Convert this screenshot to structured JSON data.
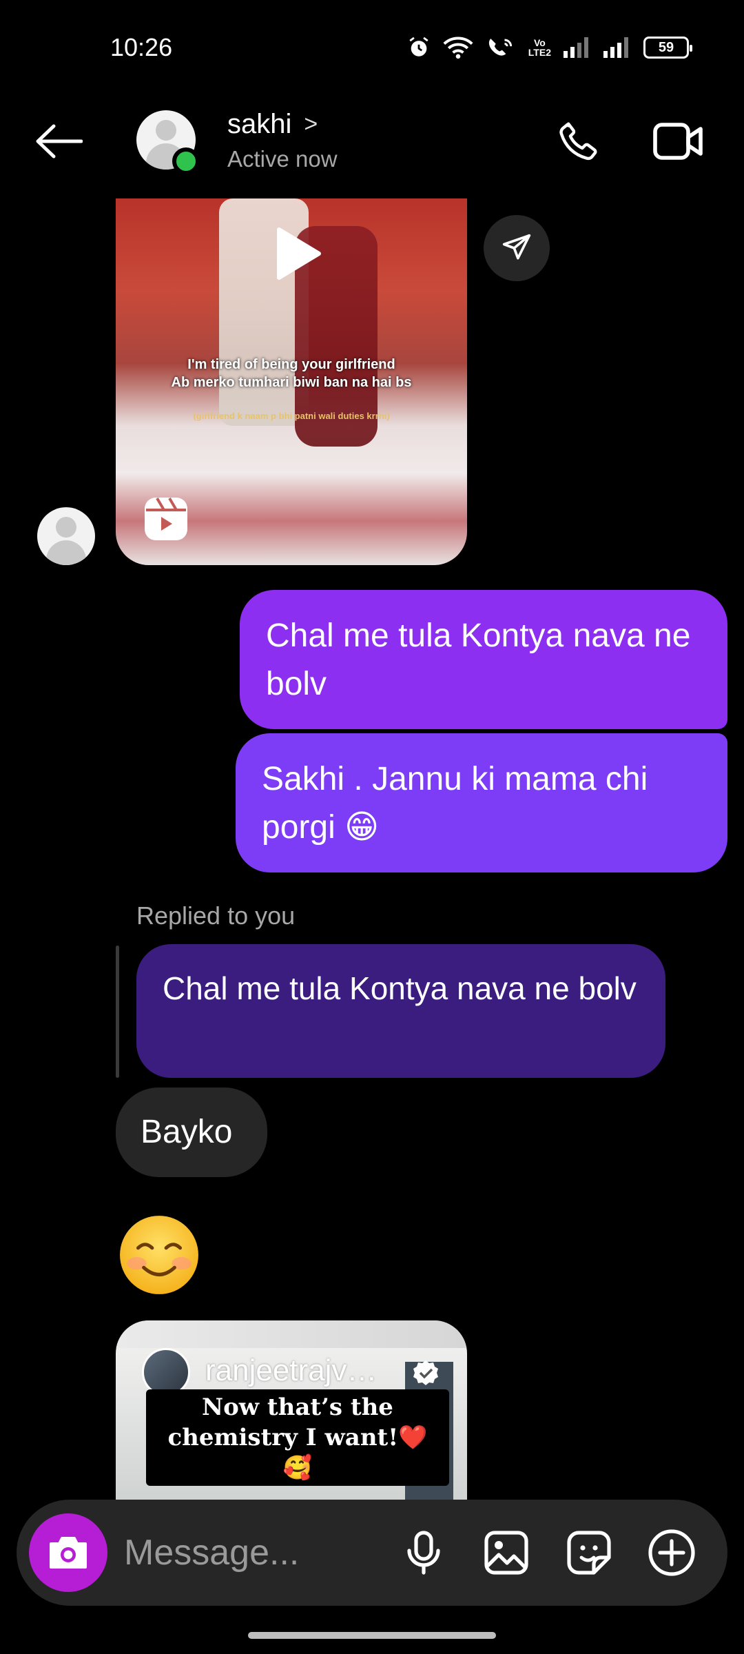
{
  "status_bar": {
    "time": "10:26",
    "network_label": "Vo\nLTE2",
    "battery": "59"
  },
  "header": {
    "contact_name": "sakhi",
    "name_chevron": ">",
    "status": "Active now",
    "icons": [
      "back-arrow-icon",
      "phone-icon",
      "video-camera-icon"
    ],
    "online_color": "#2fc24d"
  },
  "thread": {
    "reel1": {
      "caption_line1": "I'm tired of being your girlfriend",
      "caption_line2": "Ab merko tumhari biwi ban na hai bs",
      "subcaption": "(girlfriend k naam p bhi patni wali duties krrhi)",
      "icons": [
        "play-icon",
        "reels-icon",
        "share-icon"
      ]
    },
    "sent_messages": [
      "Chal me tula Kontya nava ne bolv",
      "Sakhi . Jannu ki mama chi porgi 😁"
    ],
    "reply": {
      "label": "Replied to you",
      "quoted_text": "Chal me tula Kontya nava ne bolv"
    },
    "received_messages": [
      "Bayko"
    ],
    "emoji_message": "smiling-face-with-smiling-eyes",
    "reel2": {
      "owner": "ranjeetrajv…",
      "caption": "Now that’s the chemistry I want!❤️🥰"
    }
  },
  "composer": {
    "placeholder": "Message...",
    "icons": [
      "camera-icon",
      "microphone-icon",
      "gallery-icon",
      "sticker-icon",
      "add-icon"
    ]
  },
  "colors": {
    "sent_bubble_1": "#8c2ff0",
    "sent_bubble_2": "#7d3cf5",
    "quoted_bubble": "#3b1d80",
    "received_bubble": "#262626",
    "camera_button": "#b61ed6"
  }
}
